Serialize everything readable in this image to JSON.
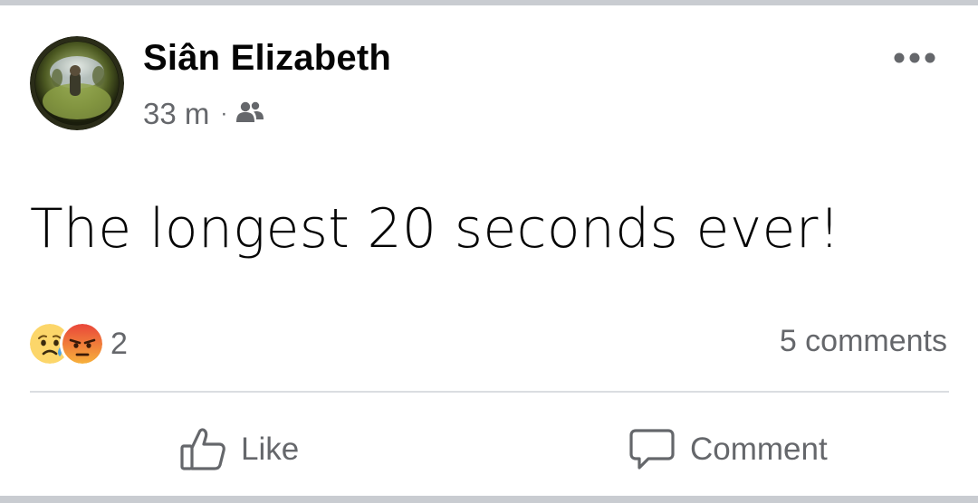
{
  "post": {
    "author": "Siân Elizabeth",
    "time": "33 m",
    "separator": "·",
    "audience_icon": "friends-icon",
    "more_icon": "more-options-icon",
    "text": "The longest 20 seconds ever!"
  },
  "reactions": {
    "icons": [
      "sad-reaction-icon",
      "angry-reaction-icon"
    ],
    "count": "2"
  },
  "comments": {
    "label": "5 comments"
  },
  "actions": {
    "like_label": "Like",
    "like_icon": "thumbs-up-icon",
    "comment_label": "Comment",
    "comment_icon": "comment-bubble-icon"
  },
  "colors": {
    "text_primary": "#050505",
    "text_secondary": "#65676b",
    "divider": "#dadde1",
    "feed_background": "#c9ccd1"
  }
}
